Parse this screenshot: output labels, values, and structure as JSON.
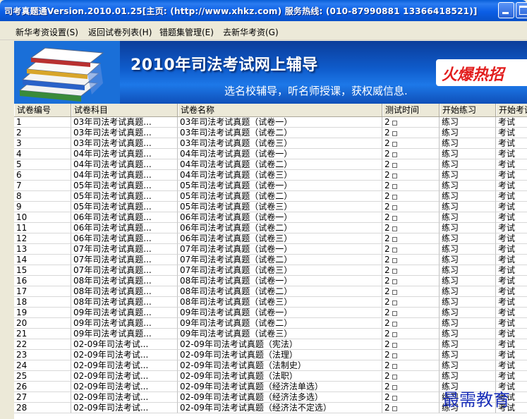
{
  "window": {
    "title": "司考真题通Version.2010.01.25[主页: (http://www.xhkz.com) 服务热线: (010-87990881  13366418521)]"
  },
  "menu": [
    "新华考资设置(S)",
    "返回试卷列表(H)",
    "错题集管理(E)",
    "去新华考资(G)"
  ],
  "banner": {
    "headline": "2010年司法考试网上辅导",
    "subtitle": "选名校辅导，听名师授课，获权威信息.",
    "promo": "火爆热招"
  },
  "table": {
    "headers": [
      "试卷编号",
      "试卷科目",
      "试卷名称",
      "测试时间",
      "开始练习",
      "开始考试"
    ],
    "rows": [
      [
        "1",
        "03年司法考试真题...",
        "03年司法考试真题（试卷一）",
        "2",
        "练习",
        "考试"
      ],
      [
        "2",
        "03年司法考试真题...",
        "03年司法考试真题（试卷二）",
        "2",
        "练习",
        "考试"
      ],
      [
        "3",
        "03年司法考试真题...",
        "03年司法考试真题（试卷三）",
        "2",
        "练习",
        "考试"
      ],
      [
        "4",
        "04年司法考试真题...",
        "04年司法考试真题（试卷一）",
        "2",
        "练习",
        "考试"
      ],
      [
        "5",
        "04年司法考试真题...",
        "04年司法考试真题（试卷二）",
        "2",
        "练习",
        "考试"
      ],
      [
        "6",
        "04年司法考试真题...",
        "04年司法考试真题（试卷三）",
        "2",
        "练习",
        "考试"
      ],
      [
        "7",
        "05年司法考试真题...",
        "05年司法考试真题（试卷一）",
        "2",
        "练习",
        "考试"
      ],
      [
        "8",
        "05年司法考试真题...",
        "05年司法考试真题（试卷二）",
        "2",
        "练习",
        "考试"
      ],
      [
        "9",
        "05年司法考试真题...",
        "05年司法考试真题（试卷三）",
        "2",
        "练习",
        "考试"
      ],
      [
        "10",
        "06年司法考试真题...",
        "06年司法考试真题（试卷一）",
        "2",
        "练习",
        "考试"
      ],
      [
        "11",
        "06年司法考试真题...",
        "06年司法考试真题（试卷二）",
        "2",
        "练习",
        "考试"
      ],
      [
        "12",
        "06年司法考试真题...",
        "06年司法考试真题（试卷三）",
        "2",
        "练习",
        "考试"
      ],
      [
        "13",
        "07年司法考试真题...",
        "07年司法考试真题（试卷一）",
        "2",
        "练习",
        "考试"
      ],
      [
        "14",
        "07年司法考试真题...",
        "07年司法考试真题（试卷二）",
        "2",
        "练习",
        "考试"
      ],
      [
        "15",
        "07年司法考试真题...",
        "07年司法考试真题（试卷三）",
        "2",
        "练习",
        "考试"
      ],
      [
        "16",
        "08年司法考试真题...",
        "08年司法考试真题（试卷一）",
        "2",
        "练习",
        "考试"
      ],
      [
        "17",
        "08年司法考试真题...",
        "08年司法考试真题（试卷二）",
        "2",
        "练习",
        "考试"
      ],
      [
        "18",
        "08年司法考试真题...",
        "08年司法考试真题（试卷三）",
        "2",
        "练习",
        "考试"
      ],
      [
        "19",
        "09年司法考试真题...",
        "09年司法考试真题（试卷一）",
        "2",
        "练习",
        "考试"
      ],
      [
        "20",
        "09年司法考试真题...",
        "09年司法考试真题（试卷二）",
        "2",
        "练习",
        "考试"
      ],
      [
        "21",
        "09年司法考试真题...",
        "09年司法考试真题（试卷三）",
        "2",
        "练习",
        "考试"
      ],
      [
        "22",
        "02-09年司法考试...",
        "02-09年司法考试真题（宪法）",
        "2",
        "练习",
        "考试"
      ],
      [
        "23",
        "02-09年司法考试...",
        "02-09年司法考试真题（法理）",
        "2",
        "练习",
        "考试"
      ],
      [
        "24",
        "02-09年司法考试...",
        "02-09年司法考试真题（法制史）",
        "2",
        "练习",
        "考试"
      ],
      [
        "25",
        "02-09年司法考试...",
        "02-09年司法考试真题（法职）",
        "2",
        "练习",
        "考试"
      ],
      [
        "26",
        "02-09年司法考试...",
        "02-09年司法考试真题（经济法单选）",
        "2",
        "练习",
        "考试"
      ],
      [
        "27",
        "02-09年司法考试...",
        "02-09年司法考试真题（经济法多选）",
        "2",
        "练习",
        "考试"
      ],
      [
        "28",
        "02-09年司法考试...",
        "02-09年司法考试真题（经济法不定选）",
        "2",
        "练习",
        "考试"
      ]
    ]
  },
  "watermark": "最需教育"
}
